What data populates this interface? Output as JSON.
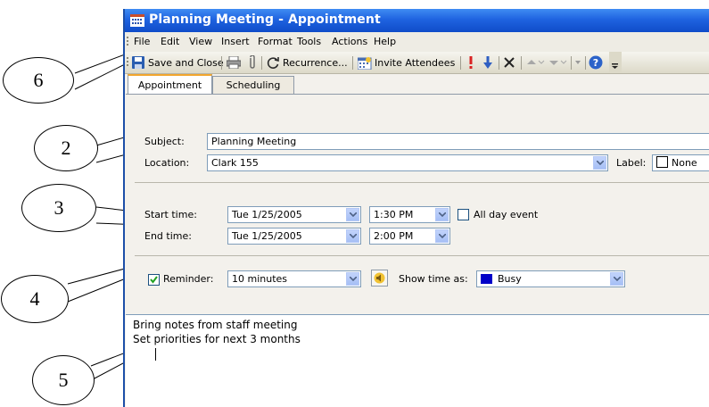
{
  "window": {
    "title": "Planning Meeting - Appointment"
  },
  "menu": [
    "File",
    "Edit",
    "View",
    "Insert",
    "Format",
    "Tools",
    "Actions",
    "Help"
  ],
  "toolbar": {
    "save_close": "Save and Close",
    "recurrence": "Recurrence...",
    "invite": "Invite Attendees"
  },
  "tabs": [
    {
      "label": "Appointment"
    },
    {
      "label": "Scheduling"
    }
  ],
  "form": {
    "subject_label": "Subject:",
    "subject": "Planning Meeting",
    "location_label": "Location:",
    "location": "Clark 155",
    "label_label": "Label:",
    "label_value": "None",
    "start_label": "Start time:",
    "start_date": "Tue 1/25/2005",
    "start_time": "1:30 PM",
    "all_day": "All day event",
    "end_label": "End time:",
    "end_date": "Tue 1/25/2005",
    "end_time": "2:00 PM",
    "reminder_label": "Reminder:",
    "reminder_checked": true,
    "reminder_value": "10 minutes",
    "show_as_label": "Show time as:",
    "show_as_value": "Busy",
    "show_as_color": "#0000c8"
  },
  "notes": [
    "Bring notes from staff meeting",
    "Set priorities for next 3 months"
  ],
  "callouts": [
    "6",
    "2",
    "3",
    "4",
    "5"
  ],
  "colors": {
    "title_bar": "#1f63e0",
    "tab_highlight": "#f2a62e",
    "field_border": "#7f9db9"
  }
}
